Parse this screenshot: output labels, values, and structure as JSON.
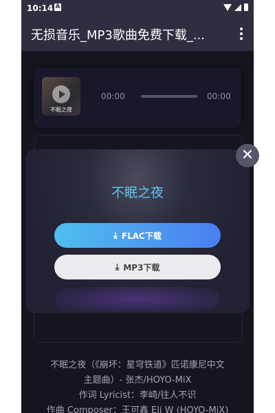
{
  "status_bar": {
    "time": "10:14",
    "notification_badge": "A",
    "icons": [
      "wifi-icon",
      "signal-icon",
      "battery-icon"
    ]
  },
  "app_bar": {
    "title": "无损音乐_MP3歌曲免费下载_...",
    "menu_icon": "more-vert-icon"
  },
  "player": {
    "album_caption": "不眠之夜",
    "current_time": "00:00",
    "total_time": "00:00",
    "progress": 0
  },
  "dialog": {
    "title": "不眠之夜",
    "flac_button": "FLAC下载",
    "mp3_button": "MP3下载",
    "download_icon": "⤓"
  },
  "close_icon": "✕",
  "lyrics": [
    "不眠之夜（《崩坏：星穹铁道》匹诺康尼中文",
    "主题曲）- 张杰/HOYO-MiX",
    "作词 Lyricist：李崎/往人不识",
    "作曲 Composer：王可鑫 Eli W (HOYO-MiX)"
  ],
  "colors": {
    "accent_title": "#5ec6ee",
    "flac_gradient_start": "#4fbff0",
    "flac_gradient_end": "#4a7ef0",
    "app_bar_bg": "#2e2e40"
  }
}
